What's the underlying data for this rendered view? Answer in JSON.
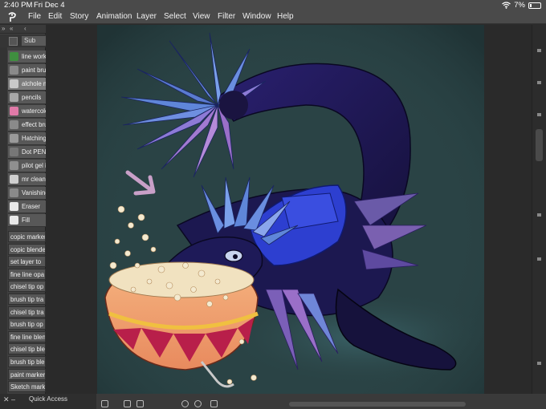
{
  "status": {
    "time": "2:40 PM",
    "date": "Fri Dec 4",
    "battery": "7%"
  },
  "menu": [
    "File",
    "Edit",
    "Story",
    "Animation",
    "Layer",
    "Select",
    "View",
    "Filter",
    "Window",
    "Help"
  ],
  "left_panel": {
    "sub_tab": "Sub",
    "brushes": [
      {
        "label": "line work",
        "icon": "pen-line-icon",
        "color": "#3f8f3f"
      },
      {
        "label": "paint brush",
        "icon": "paint-brush-icon",
        "color": "#8a8a8a"
      },
      {
        "label": "alchole m",
        "icon": "marker-icon",
        "color": "#c9c9c9"
      },
      {
        "label": "pencils",
        "icon": "pencil-icon",
        "color": "#a8a8a8"
      },
      {
        "label": "watercolor",
        "icon": "watercolor-icon",
        "color": "#e07aa8"
      },
      {
        "label": "effect bru",
        "icon": "effect-brush-icon",
        "color": "#8a8a8a"
      },
      {
        "label": "Hatching",
        "icon": "hatching-icon",
        "color": "#9a9a9a"
      },
      {
        "label": "Dot PEN",
        "icon": "dot-pen-icon",
        "color": "#777777"
      },
      {
        "label": "pilot gel i",
        "icon": "gel-pen-icon",
        "color": "#8f8f8f"
      },
      {
        "label": "mr clean",
        "icon": "mr-clean-icon",
        "color": "#cfcfcf"
      },
      {
        "label": "Vanishing",
        "icon": "vanishing-icon",
        "color": "#8a8a8a"
      },
      {
        "label": "Eraser",
        "icon": "eraser-icon",
        "color": "#e8e8e8"
      },
      {
        "label": "Fill",
        "icon": "fill-bucket-icon",
        "color": "#e8e8e8"
      }
    ],
    "actions": [
      "copic marker",
      "copic blender",
      "set layer to",
      "fine line opa",
      "chisel tip op",
      "brush tip tra",
      "chisel tip tra",
      "brush tip op",
      "fine line blen",
      "chisel tip ble",
      "brush tip ble",
      "paint marker",
      "Sketch mark"
    ]
  },
  "bottom": {
    "quick_access": "Quick Access"
  },
  "colors": {
    "canvas_bg": "#2a4345",
    "creature_body": "#1c1850",
    "feathers_blue": "#5f86d9",
    "feathers_purple": "#9a6fc8",
    "overalls": "#2d3fd0",
    "bowl": "#f0a070",
    "bowl_triangles": "#b81f4a"
  }
}
